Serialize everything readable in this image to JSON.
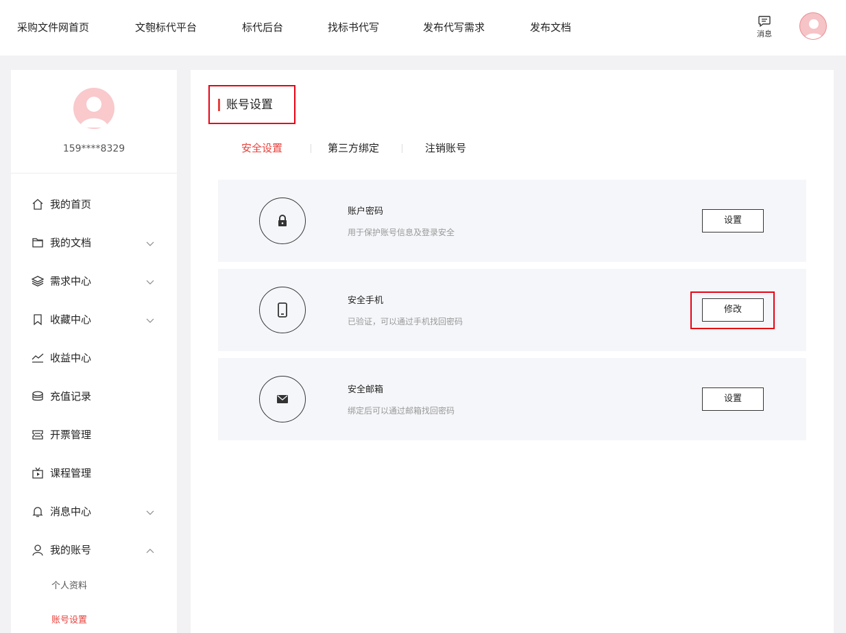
{
  "topnav": {
    "links": [
      "采购文件网首页",
      "文匏标代平台",
      "标代后台",
      "找标书代写",
      "发布代写需求",
      "发布文档"
    ],
    "message_label": "消息"
  },
  "sidebar": {
    "username": "159****8329",
    "menu": [
      {
        "label": "我的首页",
        "icon": "home-icon"
      },
      {
        "label": "我的文档",
        "icon": "folder-icon",
        "chevron": "down"
      },
      {
        "label": "需求中心",
        "icon": "layers-icon",
        "chevron": "down"
      },
      {
        "label": "收藏中心",
        "icon": "bookmark-icon",
        "chevron": "down"
      },
      {
        "label": "收益中心",
        "icon": "trend-icon"
      },
      {
        "label": "充值记录",
        "icon": "coins-icon"
      },
      {
        "label": "开票管理",
        "icon": "ticket-icon"
      },
      {
        "label": "课程管理",
        "icon": "tv-icon"
      },
      {
        "label": "消息中心",
        "icon": "bell-icon",
        "chevron": "down"
      },
      {
        "label": "我的账号",
        "icon": "user-icon",
        "chevron": "up"
      }
    ],
    "submenu": [
      "个人资料",
      "账号设置"
    ]
  },
  "main": {
    "title": "账号设置",
    "tabs": [
      "安全设置",
      "第三方绑定",
      "注销账号"
    ],
    "cards": [
      {
        "title": "账户密码",
        "desc": "用于保护账号信息及登录安全",
        "button": "设置",
        "icon": "lock-icon"
      },
      {
        "title": "安全手机",
        "desc": "已验证，可以通过手机找回密码",
        "button": "修改",
        "icon": "phone-icon"
      },
      {
        "title": "安全邮箱",
        "desc": "绑定后可以通过邮箱找回密码",
        "button": "设置",
        "icon": "mail-icon"
      }
    ]
  },
  "colors": {
    "accent": "#e8403b",
    "highlight": "#e60012",
    "card_bg": "#f5f6f9"
  }
}
